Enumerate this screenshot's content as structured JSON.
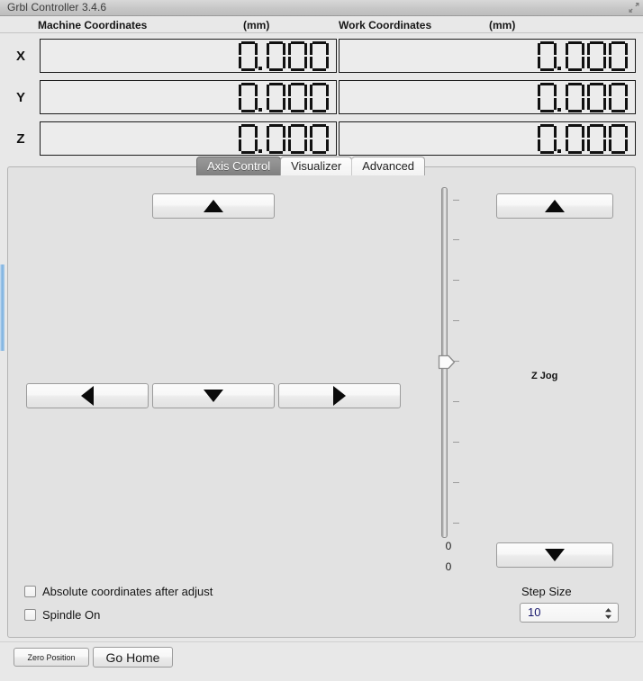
{
  "window": {
    "title": "Grbl Controller 3.4.6",
    "resize_icon": "resize-grip-icon"
  },
  "coordinates": {
    "machine": {
      "label": "Machine Coordinates",
      "units": "(mm)",
      "axes": [
        {
          "name": "X",
          "value": "0.000"
        },
        {
          "name": "Y",
          "value": "0.000"
        },
        {
          "name": "Z",
          "value": "0.000"
        }
      ]
    },
    "work": {
      "label": "Work Coordinates",
      "units": "(mm)",
      "axes": [
        {
          "name": "X",
          "value": "0.000"
        },
        {
          "name": "Y",
          "value": "0.000"
        },
        {
          "name": "Z",
          "value": "0.000"
        }
      ]
    }
  },
  "tabs": [
    {
      "label": "Axis Control",
      "selected": true
    },
    {
      "label": "Visualizer",
      "selected": false
    },
    {
      "label": "Advanced",
      "selected": false
    }
  ],
  "axis_control": {
    "jog_buttons": {
      "y_plus": "arrow-up-icon",
      "x_minus": "arrow-left-icon",
      "y_minus": "arrow-down-icon",
      "x_plus": "arrow-right-icon",
      "z_plus": "arrow-up-icon",
      "z_minus": "arrow-down-icon"
    },
    "z_jog_label": "Z Jog",
    "slider": {
      "value_top": "0",
      "value_bottom": "0"
    },
    "checkboxes": [
      {
        "label": "Absolute coordinates after adjust",
        "checked": false
      },
      {
        "label": "Spindle On",
        "checked": false
      }
    ],
    "step_size": {
      "label": "Step Size",
      "value": "10"
    }
  },
  "bottom_buttons": [
    {
      "label": "Zero Position"
    },
    {
      "label": "Go Home"
    }
  ],
  "colors": {
    "window_bg": "#e8e8e8",
    "panel_bg": "#e2e2e2",
    "tab_selected_bg": "#8a8a8a",
    "lcd_bg": "#ececec",
    "lcd_segment": "#111111",
    "edge_highlight": "#7fb2e0"
  }
}
